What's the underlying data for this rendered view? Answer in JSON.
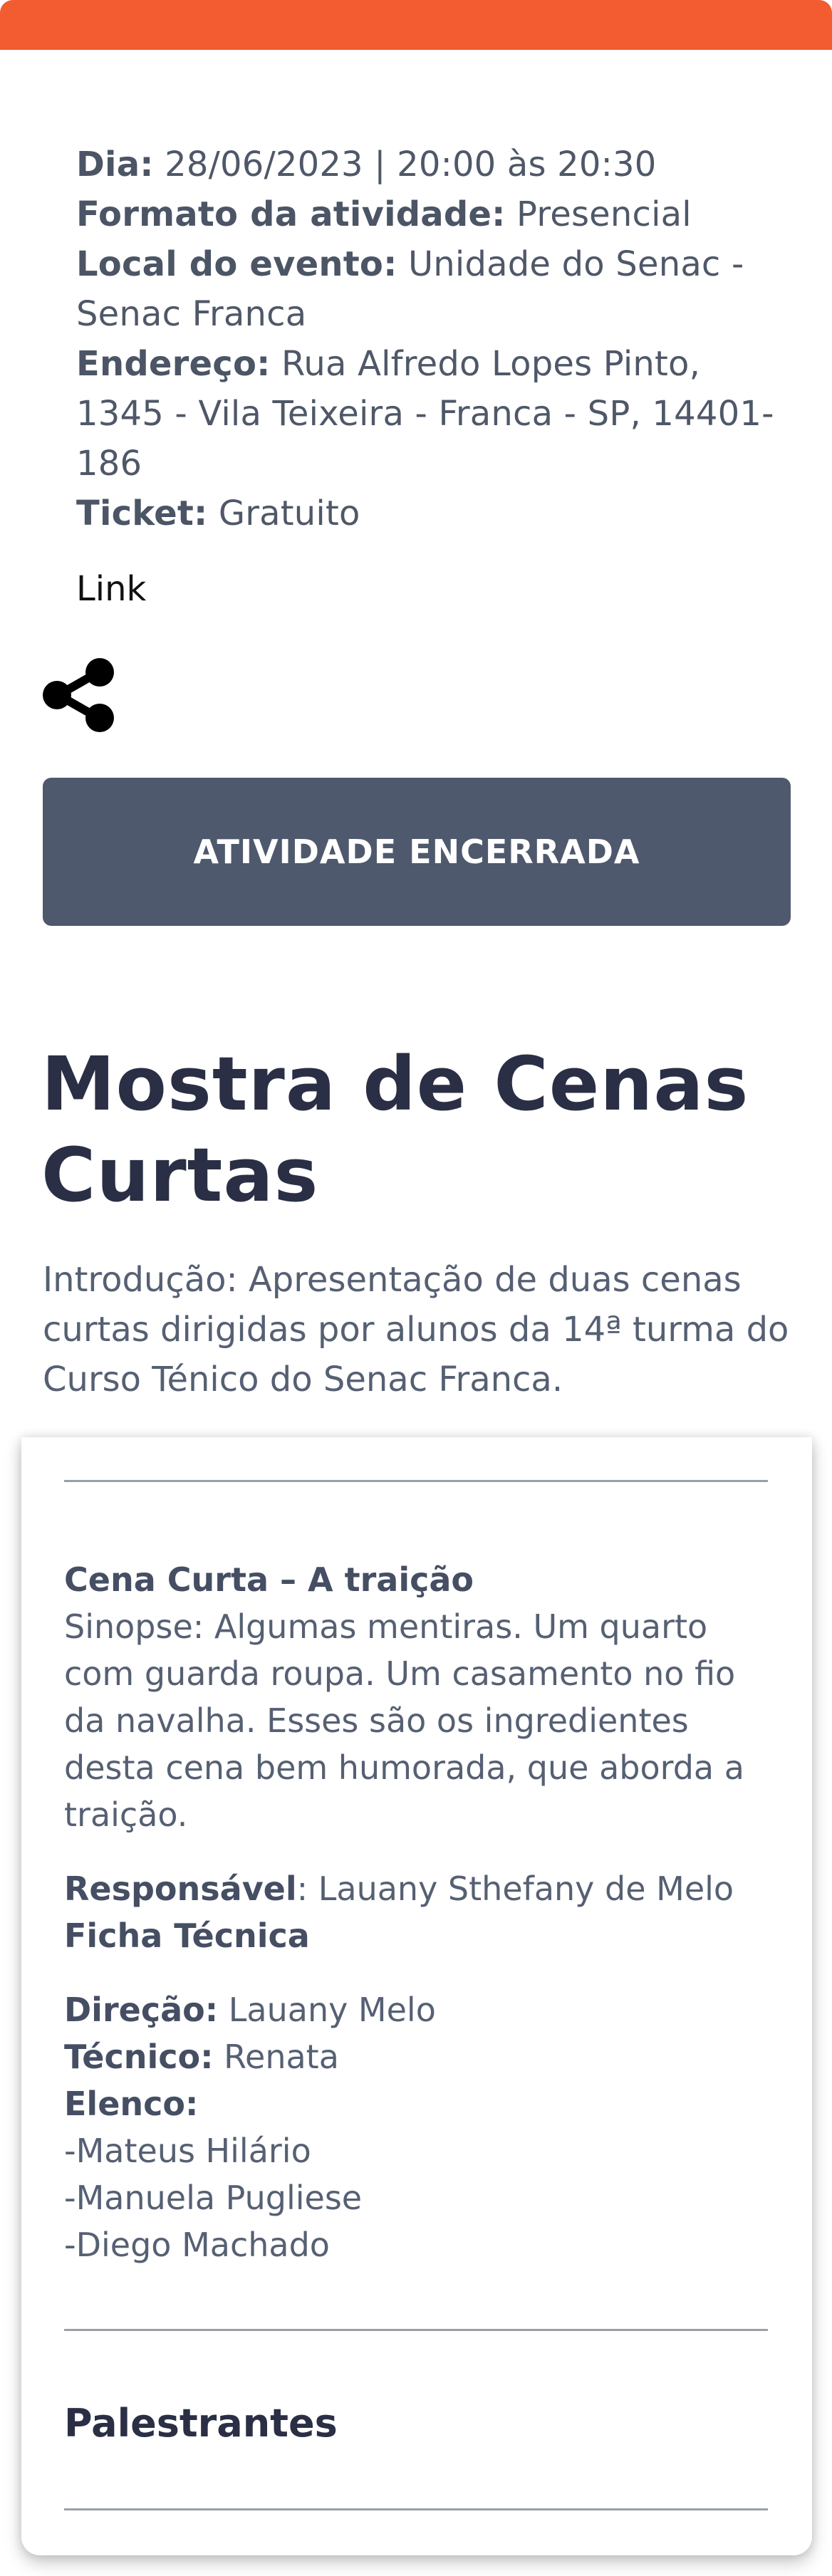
{
  "event": {
    "day_label": "Dia:",
    "day_value": " 28/06/2023 | 20:00 às 20:30",
    "format_label": "Formato da atividade:",
    "format_value": " Presencial",
    "location_label": "Local do evento:",
    "location_value": " Unidade do Senac - Senac Franca",
    "address_label": "Endereço:",
    "address_value": " Rua Alfredo Lopes Pinto, 1345 - Vila Teixeira - Franca - SP, 14401-186",
    "ticket_label": "Ticket:",
    "ticket_value": " Gratuito",
    "link_text": "Link"
  },
  "status_button": "ATIVIDADE ENCERRADA",
  "title": "Mostra de Cenas Curtas",
  "intro": "Introdução: Apresentação de duas cenas curtas dirigidas por alunos da 14ª turma do Curso Ténico do Senac Franca.",
  "scene": {
    "title": "Cena Curta – A traição",
    "synopsis": "Sinopse: Algumas mentiras. Um quarto com guarda roupa. Um casamento no fio da navalha. Esses são os ingredientes desta cena bem humorada, que aborda a traição.",
    "responsible_label": "Responsável",
    "responsible_value": ": Lauany Sthefany de Melo",
    "tech_sheet_label": "Ficha Técnica",
    "direction_label": "Direção:",
    "direction_value": " Lauany Melo",
    "technician_label": "Técnico:",
    "technician_value": " Renata",
    "cast_label": "Elenco:",
    "cast": [
      "-Mateus Hilário",
      "-Manuela Pugliese",
      "-Diego Machado"
    ]
  },
  "speakers_heading": "Palestrantes",
  "icons": {
    "share": "share-icon"
  },
  "colors": {
    "accent": "#f35b30",
    "button": "#4f596d",
    "title": "#2a2f45"
  }
}
